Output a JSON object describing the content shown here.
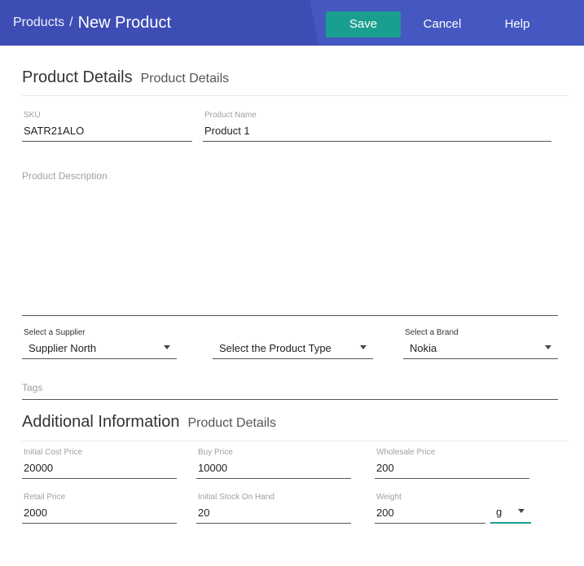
{
  "header": {
    "breadcrumb_parent": "Products",
    "breadcrumb_separator": "/",
    "page_title": "New Product",
    "save_label": "Save",
    "cancel_label": "Cancel",
    "help_label": "Help",
    "colors": {
      "bar": "#3e4db4",
      "save": "#1a9e8f"
    }
  },
  "product_details": {
    "heading": "Product Details",
    "subheading": "Product Details",
    "sku": {
      "label": "SKU",
      "value": "SATR21ALO"
    },
    "product_name": {
      "label": "Product Name",
      "value": "Product 1"
    },
    "description": {
      "placeholder": "Product Description",
      "value": ""
    },
    "supplier": {
      "label": "Select a Supplier",
      "value": "Supplier North"
    },
    "product_type": {
      "label": "",
      "value": "Select the Product Type"
    },
    "brand": {
      "label": "Select a Brand",
      "value": "Nokia"
    },
    "tags": {
      "placeholder": "Tags",
      "value": ""
    }
  },
  "additional_info": {
    "heading": "Additional Information",
    "subheading": "Product Details",
    "initial_cost_price": {
      "label": "Initial Cost Price",
      "value": "20000"
    },
    "buy_price": {
      "label": "Buy Price",
      "value": "10000"
    },
    "wholesale_price": {
      "label": "Wholesale Price",
      "value": "200"
    },
    "retail_price": {
      "label": "Retail Price",
      "value": "2000"
    },
    "initial_stock": {
      "label": "Initial Stock On Hand",
      "value": "20"
    },
    "weight": {
      "label": "Weight",
      "value": "200"
    },
    "weight_unit": {
      "value": "g"
    }
  }
}
